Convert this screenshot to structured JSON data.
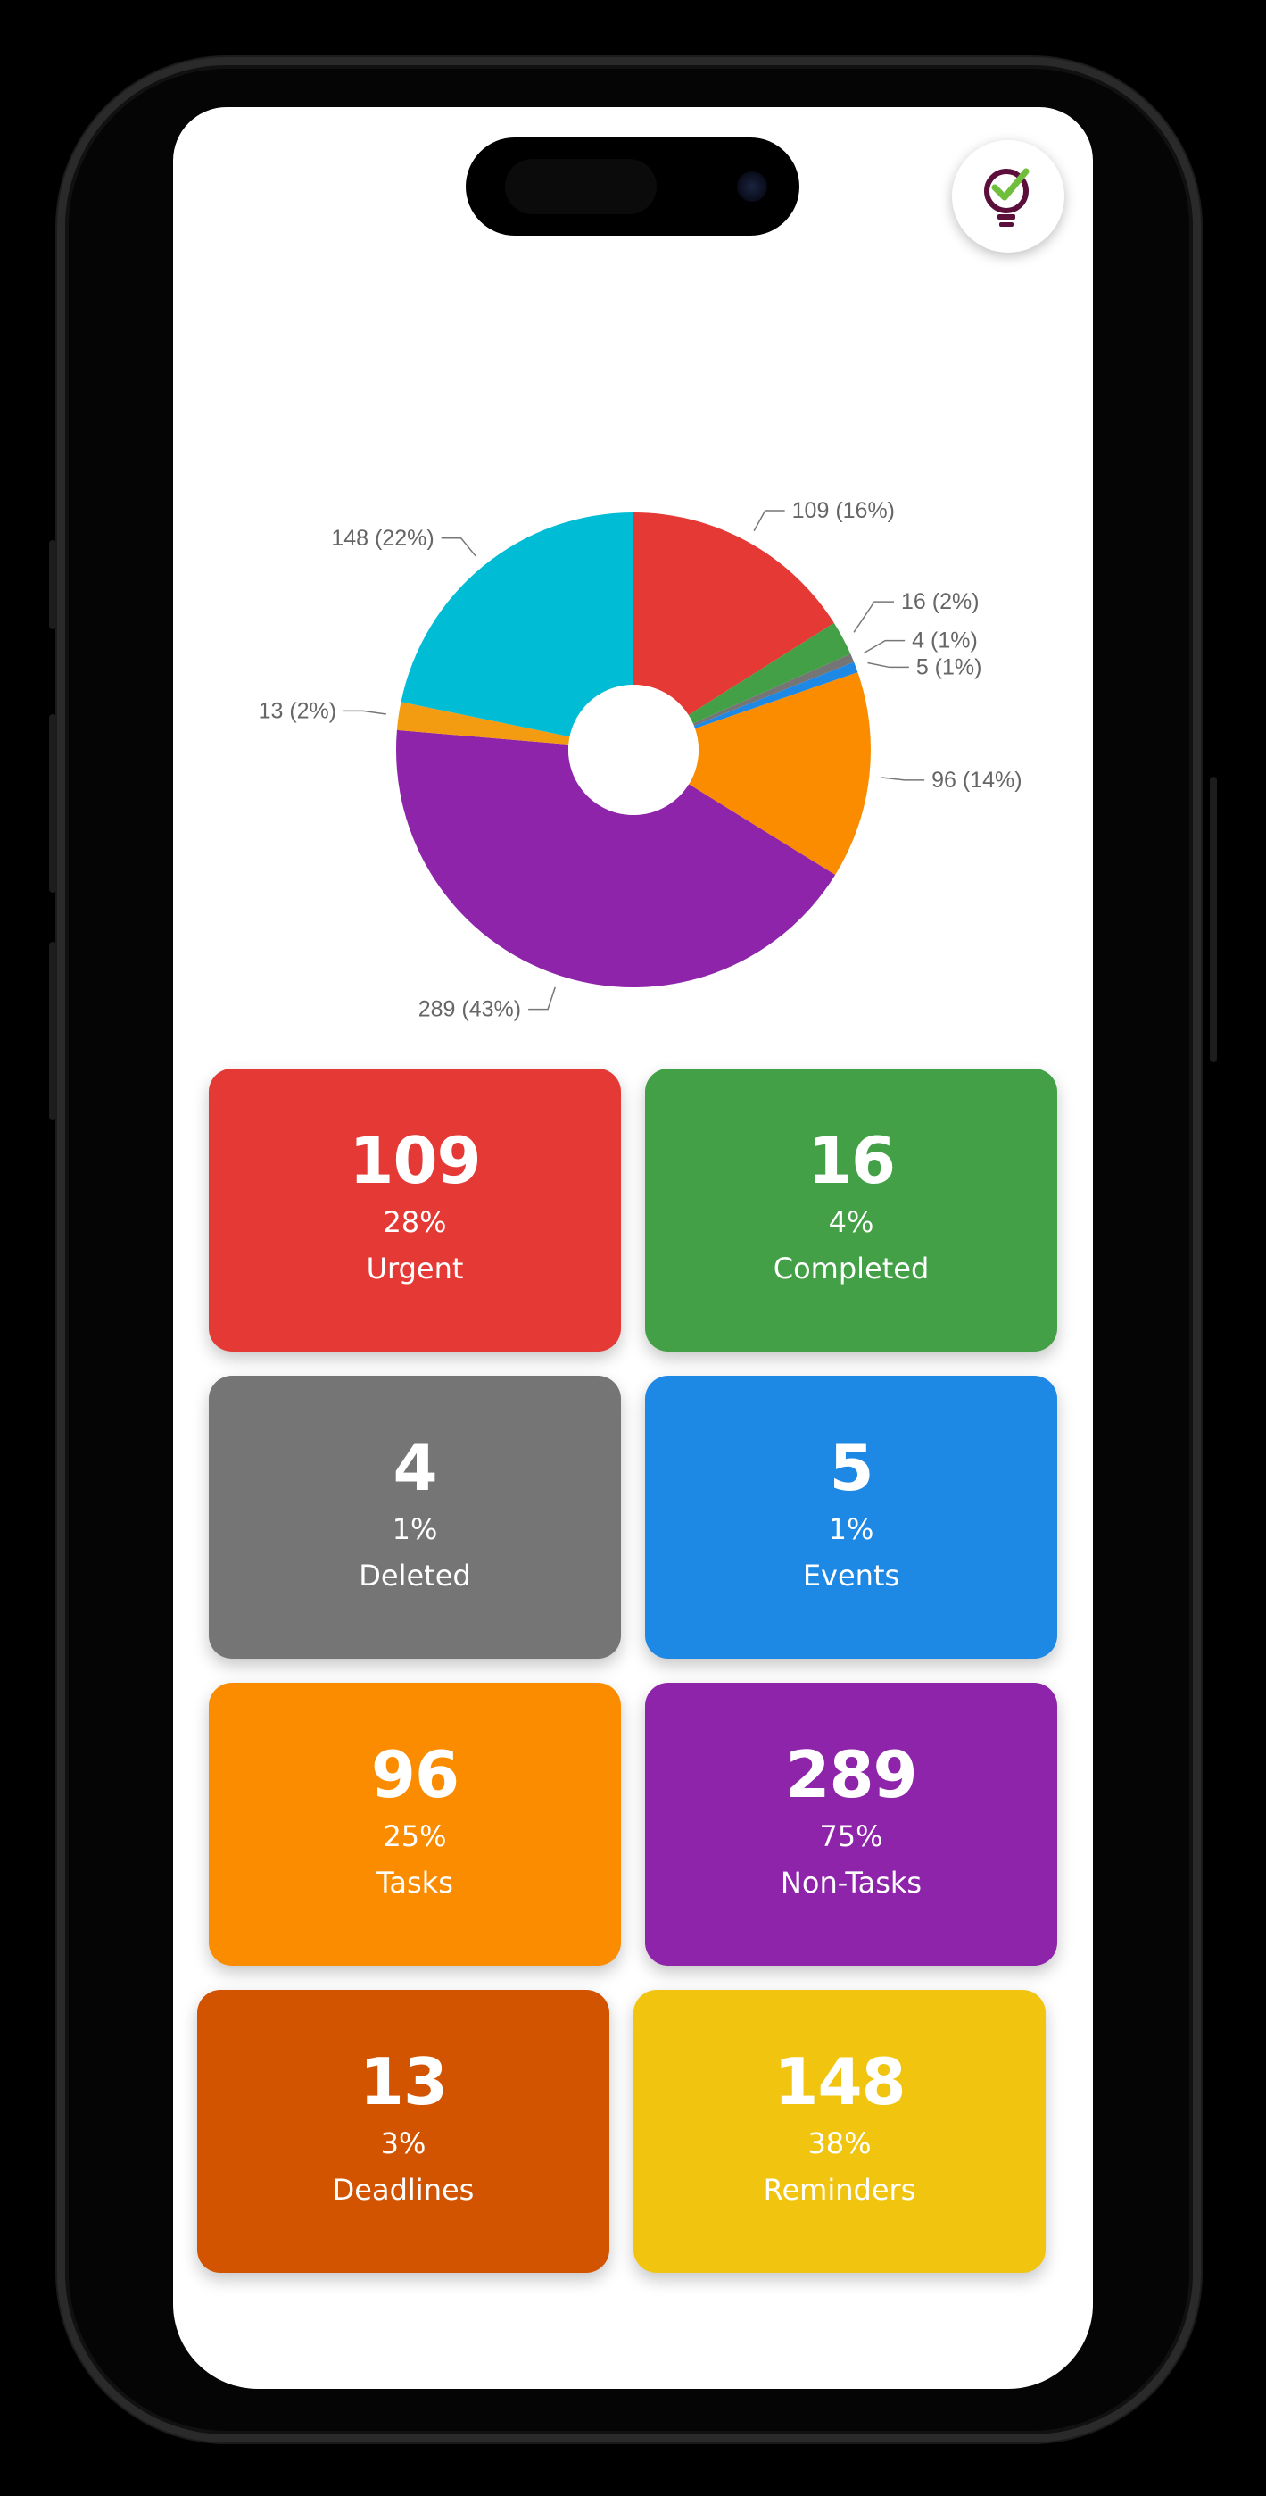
{
  "app": {
    "logo_icon": "lightbulb-check-icon",
    "colors": {
      "urgent": "#E53935",
      "completed": "#43A047",
      "deleted": "#757575",
      "events": "#1E88E5",
      "tasks": "#FB8C00",
      "non_tasks": "#8E24AA",
      "deadlines": "#D35400",
      "reminders": "#F1C40F"
    }
  },
  "chart_data": {
    "type": "pie",
    "donut": true,
    "slices": [
      {
        "name": "Urgent",
        "value": 109,
        "label": "109 (16%)",
        "color": "#E53935"
      },
      {
        "name": "Completed",
        "value": 16,
        "label": "16 (2%)",
        "color": "#43A047"
      },
      {
        "name": "Deleted",
        "value": 4,
        "label": "4 (1%)",
        "color": "#757575"
      },
      {
        "name": "Events",
        "value": 5,
        "label": "5 (1%)",
        "color": "#1E88E5"
      },
      {
        "name": "Tasks",
        "value": 96,
        "label": "96 (14%)",
        "color": "#FB8C00"
      },
      {
        "name": "Non-Tasks",
        "value": 289,
        "label": "289 (43%)",
        "color": "#8E24AA"
      },
      {
        "name": "Deadlines",
        "value": 13,
        "label": "13 (2%)",
        "color": "#F39C12"
      },
      {
        "name": "Reminders",
        "value": 148,
        "label": "148 (22%)",
        "color": "#00BCD4"
      }
    ]
  },
  "cards": [
    {
      "key": "urgent",
      "count": "109",
      "percent": "28%",
      "label": "Urgent",
      "color": "#E53935"
    },
    {
      "key": "completed",
      "count": "16",
      "percent": "4%",
      "label": "Completed",
      "color": "#43A047"
    },
    {
      "key": "deleted",
      "count": "4",
      "percent": "1%",
      "label": "Deleted",
      "color": "#757575"
    },
    {
      "key": "events",
      "count": "5",
      "percent": "1%",
      "label": "Events",
      "color": "#1E88E5"
    },
    {
      "key": "tasks",
      "count": "96",
      "percent": "25%",
      "label": "Tasks",
      "color": "#FB8C00"
    },
    {
      "key": "non-tasks",
      "count": "289",
      "percent": "75%",
      "label": "Non-Tasks",
      "color": "#8E24AA"
    },
    {
      "key": "deadlines",
      "count": "13",
      "percent": "3%",
      "label": "Deadlines",
      "color": "#D35400"
    },
    {
      "key": "reminders",
      "count": "148",
      "percent": "38%",
      "label": "Reminders",
      "color": "#F1C40F"
    }
  ]
}
